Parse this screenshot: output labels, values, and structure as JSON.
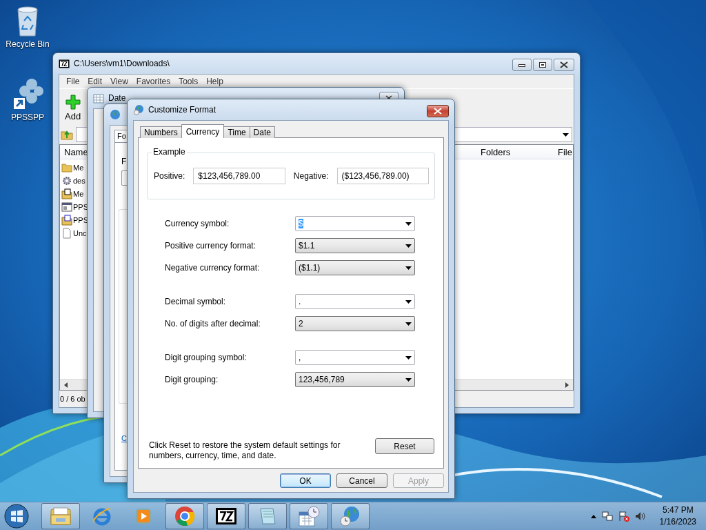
{
  "desktop_icons": [
    {
      "label": "Recycle Bin",
      "kind": "bin"
    },
    {
      "label": "PPSSPP",
      "kind": "ppsspp"
    }
  ],
  "file_manager": {
    "title": "C:\\Users\\vm1\\Downloads\\",
    "menu": [
      "File",
      "Edit",
      "View",
      "Favorites",
      "Tools",
      "Help"
    ],
    "toolbar": [
      "Add"
    ],
    "columns": [
      "Name",
      "Folders",
      "File"
    ],
    "rows": [
      {
        "name": "Me",
        "kind": "folder"
      },
      {
        "name": "des",
        "kind": "settings"
      },
      {
        "name": "Me",
        "kind": "archive7"
      },
      {
        "name": "PPS",
        "kind": "exe"
      },
      {
        "name": "PPS",
        "kind": "archivez"
      },
      {
        "name": "Unc",
        "kind": "file"
      }
    ],
    "status": "0 / 6 ob"
  },
  "date_time_window": {
    "title": "Date"
  },
  "region_window": {
    "tab": "Fo",
    "label": "F",
    "link": "C"
  },
  "dialog": {
    "title": "Customize Format",
    "tabs": [
      {
        "label": "Numbers",
        "selected": false
      },
      {
        "label": "Currency",
        "selected": true
      },
      {
        "label": "Time",
        "selected": false
      },
      {
        "label": "Date",
        "selected": false
      }
    ],
    "example": {
      "title": "Example",
      "positive_label": "Positive:",
      "positive": "$123,456,789.00",
      "negative_label": "Negative:",
      "negative": "($123,456,789.00)"
    },
    "groups": [
      [
        {
          "label": "Currency symbol:",
          "value": "$",
          "kind": "edit",
          "text_selected": true
        },
        {
          "label": "Positive currency format:",
          "value": "$1.1",
          "kind": "list",
          "text_selected": false
        },
        {
          "label": "Negative currency format:",
          "value": "($1.1)",
          "kind": "list",
          "text_selected": false
        }
      ],
      [
        {
          "label": "Decimal symbol:",
          "value": ".",
          "kind": "edit",
          "text_selected": false
        },
        {
          "label": "No. of digits after decimal:",
          "value": "2",
          "kind": "list",
          "text_selected": false
        }
      ],
      [
        {
          "label": "Digit grouping symbol:",
          "value": ",",
          "kind": "edit",
          "text_selected": false
        },
        {
          "label": "Digit grouping:",
          "value": "123,456,789",
          "kind": "list",
          "text_selected": false
        }
      ]
    ],
    "note": "Click Reset to restore the system default settings for numbers, currency, time, and date.",
    "reset": "Reset",
    "buttons": [
      {
        "label": "OK",
        "default": true,
        "disabled": false
      },
      {
        "label": "Cancel",
        "default": false,
        "disabled": false
      },
      {
        "label": "Apply",
        "default": false,
        "disabled": true
      }
    ]
  },
  "taskbar": {
    "apps": [
      {
        "kind": "explorer",
        "running": true
      },
      {
        "kind": "ie",
        "running": false
      },
      {
        "kind": "media",
        "running": false
      },
      {
        "kind": "chrome",
        "running": true
      },
      {
        "kind": "sevenzip",
        "running": true
      },
      {
        "kind": "notepad",
        "running": true
      },
      {
        "kind": "datetime",
        "running": true
      },
      {
        "kind": "globe",
        "running": true
      }
    ],
    "time": "5:47 PM",
    "date": "1/16/2023"
  }
}
